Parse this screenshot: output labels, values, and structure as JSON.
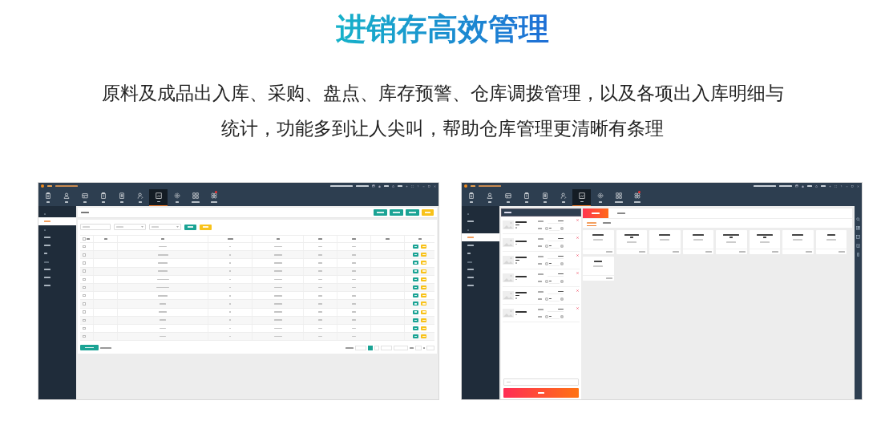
{
  "header": {
    "title": "进销存高效管理",
    "lines": [
      "原料及成品出入库、采购、盘点、库存预警、仓库调拨管理，以及各项出入库明细与",
      "统计，功能多到让人尖叫，帮助仓库管理更清晰有条理"
    ]
  },
  "windows": [
    {
      "kind": "product_settings",
      "nav": [
        {
          "selected": false,
          "notify": false
        },
        {
          "selected": false,
          "notify": false
        },
        {
          "selected": false,
          "notify": false
        },
        {
          "selected": false,
          "notify": false
        },
        {
          "selected": false,
          "notify": false
        },
        {
          "selected": false,
          "notify": false
        },
        {
          "selected": true,
          "notify": false
        },
        {
          "selected": false,
          "notify": false
        },
        {
          "selected": false,
          "notify": false
        },
        {
          "selected": false,
          "notify": true
        }
      ],
      "sidebar": [
        {
          "kind": "section"
        },
        {
          "kind": "item",
          "selected": true
        },
        {
          "kind": "section"
        },
        {
          "kind": "item",
          "selected": false
        },
        {
          "kind": "item",
          "selected": false
        },
        {
          "kind": "item",
          "selected": false
        },
        {
          "kind": "section"
        },
        {
          "kind": "item",
          "selected": false
        },
        {
          "kind": "item",
          "selected": false
        },
        {
          "kind": "item",
          "selected": false
        }
      ],
      "table": {
        "select_all": false,
        "rows": [
          {
            "checked": false
          },
          {
            "checked": false
          },
          {
            "checked": false
          },
          {
            "checked": false
          },
          {
            "checked": false
          },
          {
            "checked": false
          },
          {
            "checked": false
          },
          {
            "checked": false
          },
          {
            "checked": false
          },
          {
            "checked": false
          },
          {
            "checked": false
          },
          {
            "checked": false
          }
        ]
      },
      "pages": [
        {
          "selected": true
        },
        {
          "selected": false
        }
      ]
    },
    {
      "kind": "stock_in",
      "nav": [
        {
          "selected": false,
          "notify": false
        },
        {
          "selected": false,
          "notify": false
        },
        {
          "selected": false,
          "notify": false
        },
        {
          "selected": false,
          "notify": false
        },
        {
          "selected": false,
          "notify": false
        },
        {
          "selected": false,
          "notify": false
        },
        {
          "selected": true,
          "notify": false
        },
        {
          "selected": false,
          "notify": false
        },
        {
          "selected": false,
          "notify": false
        },
        {
          "selected": false,
          "notify": true
        }
      ],
      "sidebar": [
        {
          "kind": "section"
        },
        {
          "kind": "item",
          "selected": false
        },
        {
          "kind": "section"
        },
        {
          "kind": "item",
          "selected": true
        },
        {
          "kind": "item",
          "selected": false
        },
        {
          "kind": "item",
          "selected": false
        },
        {
          "kind": "section"
        },
        {
          "kind": "item",
          "selected": false
        },
        {
          "kind": "item",
          "selected": false
        },
        {
          "kind": "item",
          "selected": false
        }
      ],
      "tabs": [
        {
          "selected": true
        },
        {
          "selected": false
        }
      ],
      "subtabs": [
        {
          "selected": true
        },
        {
          "selected": false
        }
      ]
    }
  ]
}
